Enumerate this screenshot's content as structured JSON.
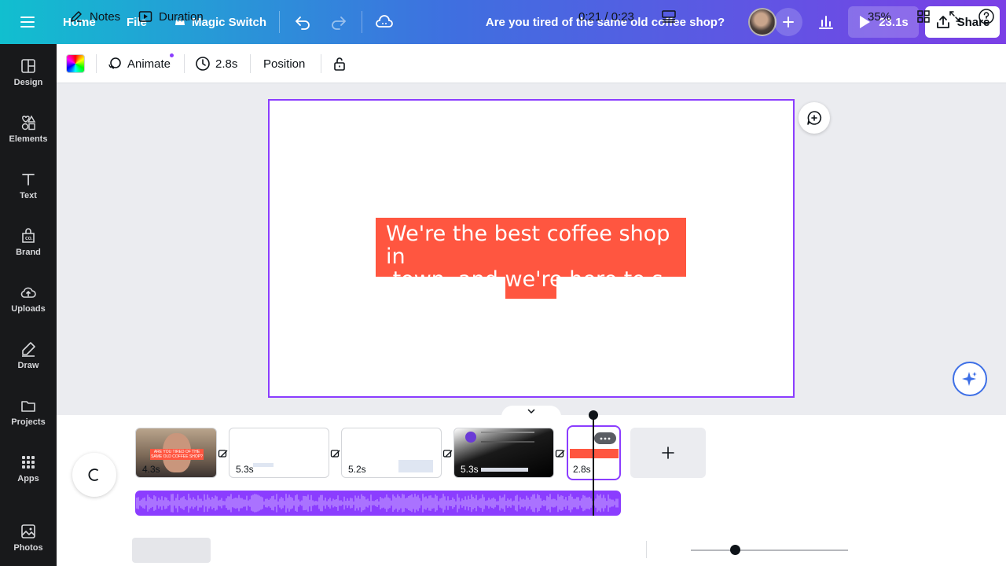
{
  "topbar": {
    "home": "Home",
    "file": "File",
    "magic_switch": "Magic Switch",
    "title": "Are you tired of the same old coffee shop?",
    "play_duration": "23.1s",
    "share": "Share"
  },
  "sidebar": {
    "items": [
      {
        "label": "Design",
        "icon": "layout-icon"
      },
      {
        "label": "Elements",
        "icon": "shapes-icon"
      },
      {
        "label": "Text",
        "icon": "text-icon"
      },
      {
        "label": "Brand",
        "icon": "brand-icon"
      },
      {
        "label": "Uploads",
        "icon": "cloud-upload-icon"
      },
      {
        "label": "Draw",
        "icon": "pen-icon"
      },
      {
        "label": "Projects",
        "icon": "folder-icon"
      },
      {
        "label": "Apps",
        "icon": "grid-icon"
      },
      {
        "label": "Photos",
        "icon": "image-icon"
      }
    ]
  },
  "toolbar": {
    "animate": "Animate",
    "duration": "2.8s",
    "position": "Position"
  },
  "canvas": {
    "text": "We're the best coffee shop in\n town, and we're here to s",
    "text_bg_color": "#ff5640",
    "selection_color": "#8b3dff"
  },
  "timeline": {
    "clips": [
      {
        "duration": "4.3s",
        "caption": "ARE YOU TIRED OF THE SAME OLD COFFEE SHOP?"
      },
      {
        "duration": "5.3s",
        "caption": ""
      },
      {
        "duration": "5.2s",
        "caption": ""
      },
      {
        "duration": "5.3s",
        "caption": ""
      },
      {
        "duration": "2.8s",
        "caption": ""
      }
    ]
  },
  "bottombar": {
    "notes": "Notes",
    "duration": "Duration",
    "time": "0:21 / 0:23",
    "zoom": "35%",
    "zoom_level": 0.35
  }
}
